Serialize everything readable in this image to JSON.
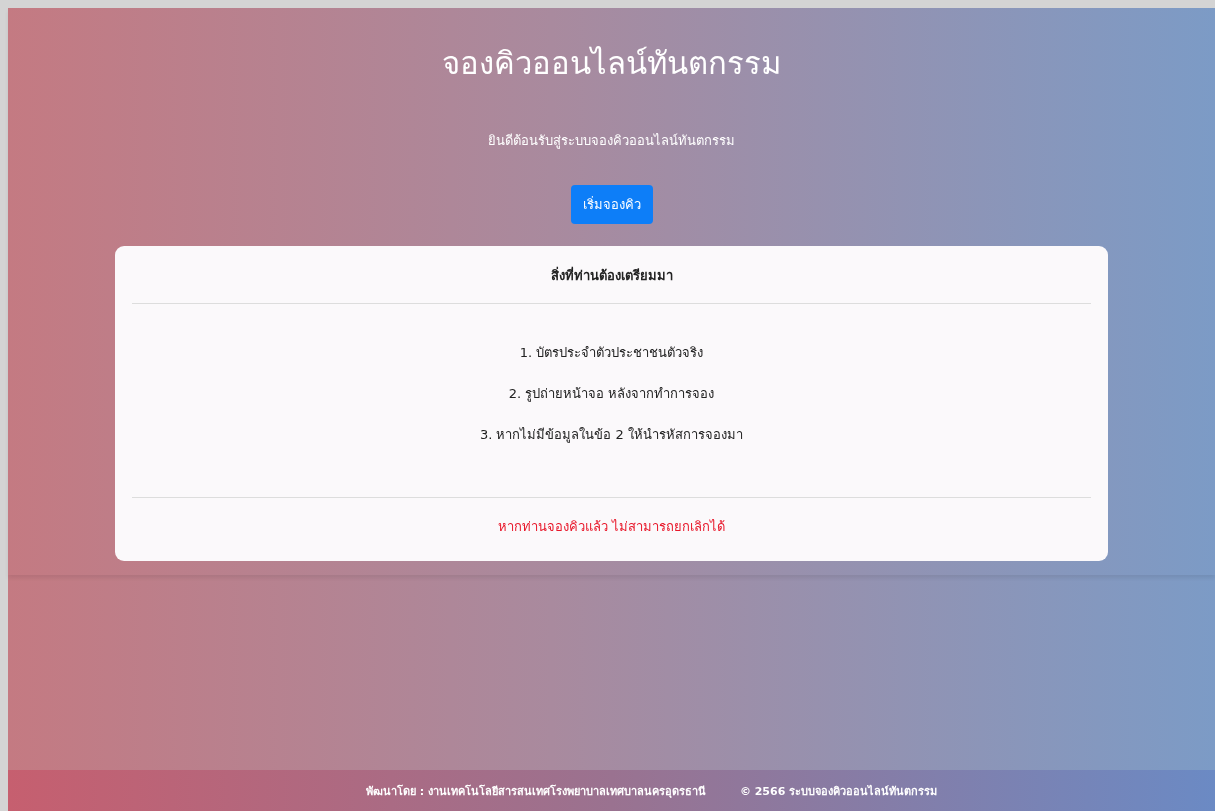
{
  "header": {
    "title": "จองคิวออนไลน์ทันตกรรม",
    "subtitle": "ยินดีต้อนรับสู่ระบบจองคิวออนไลน์ทันตกรรม",
    "button": "เริ่มจองคิว"
  },
  "card": {
    "title": "สิ่งที่ท่านต้องเตรียมมา",
    "items": [
      "1. บัตรประจำตัวประชาชนตัวจริง",
      "2. รูปถ่ายหน้าจอ หลังจากทำการจอง",
      "3. หากไม่มีข้อมูลในข้อ 2 ให้นำรหัสการจองมา"
    ],
    "warning": "หากท่านจองคิวแล้ว ไม่สามารถยกเลิกได้"
  },
  "footer": {
    "developer": "พัฒนาโดย : งานเทคโนโลยีสารสนเทศโรงพยาบาลเทศบาลนครอุดรธานี",
    "copyright": "© 2566 ระบบจองคิวออนไลน์ทันตกรรม"
  }
}
